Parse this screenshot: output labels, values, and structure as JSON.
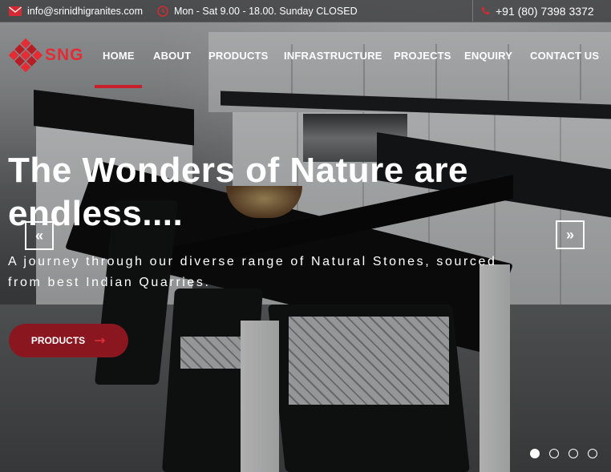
{
  "topbar": {
    "email": "info@srinidhigranites.com",
    "hours": "Mon - Sat 9.00 - 18.00. Sunday CLOSED",
    "phone": "+91 (80) 7398 3372"
  },
  "brand": {
    "logo_text": "SNG"
  },
  "nav": {
    "items": [
      "HOME",
      "ABOUT",
      "PRODUCTS",
      "INFRASTRUCTURE",
      "PROJECTS",
      "ENQUIRY",
      "CONTACT US"
    ],
    "active": "HOME"
  },
  "hero": {
    "headline_line1": "The Wonders of Nature are",
    "headline_line2": "endless....",
    "subtext_line1": "A journey through our diverse range of Natural Stones, sourced",
    "subtext_line2": "from best Indian Quarries.",
    "cta_label": "PRODUCTS",
    "prev_glyph": "«",
    "next_glyph": "»",
    "slides": 4,
    "active_slide": 1
  },
  "colors": {
    "accent": "#c81f29",
    "cta": "#8a1720"
  }
}
